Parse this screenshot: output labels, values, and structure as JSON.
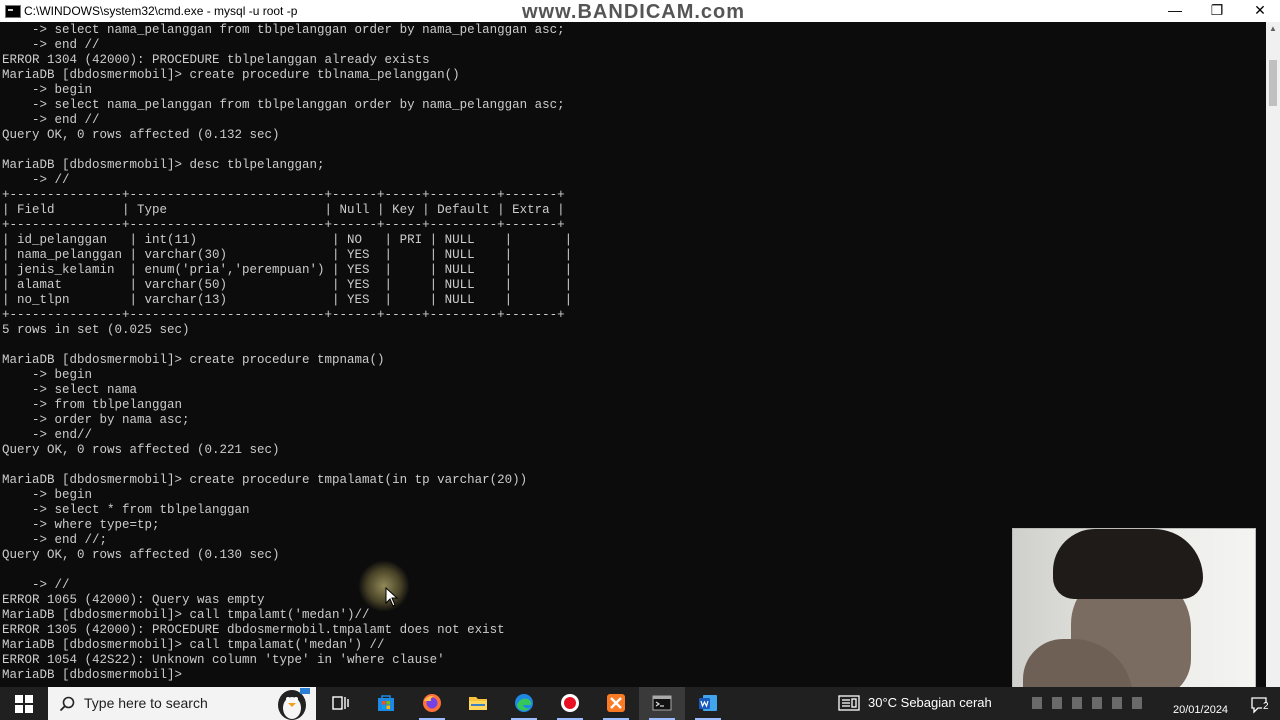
{
  "window": {
    "title": "C:\\WINDOWS\\system32\\cmd.exe - mysql  -u root -p",
    "watermark": "www.BANDICAM.com",
    "minimize_label": "—",
    "maximize_label": "❐",
    "close_label": "✕"
  },
  "console": {
    "lines": [
      "    -> select nama_pelanggan from tblpelanggan order by nama_pelanggan asc;",
      "    -> end //",
      "ERROR 1304 (42000): PROCEDURE tblpelanggan already exists",
      "MariaDB [dbdosmermobil]> create procedure tblnama_pelanggan()",
      "    -> begin",
      "    -> select nama_pelanggan from tblpelanggan order by nama_pelanggan asc;",
      "    -> end //",
      "Query OK, 0 rows affected (0.132 sec)",
      "",
      "MariaDB [dbdosmermobil]> desc tblpelanggan;",
      "    -> //",
      "+---------------+--------------------------+------+-----+---------+-------+",
      "| Field         | Type                     | Null | Key | Default | Extra |",
      "+---------------+--------------------------+------+-----+---------+-------+",
      "| id_pelanggan   | int(11)                  | NO   | PRI | NULL    |       |",
      "| nama_pelanggan | varchar(30)              | YES  |     | NULL    |       |",
      "| jenis_kelamin  | enum('pria','perempuan') | YES  |     | NULL    |       |",
      "| alamat         | varchar(50)              | YES  |     | NULL    |       |",
      "| no_tlpn        | varchar(13)              | YES  |     | NULL    |       |",
      "+---------------+--------------------------+------+-----+---------+-------+",
      "5 rows in set (0.025 sec)",
      "",
      "MariaDB [dbdosmermobil]> create procedure tmpnama()",
      "    -> begin",
      "    -> select nama",
      "    -> from tblpelanggan",
      "    -> order by nama asc;",
      "    -> end//",
      "Query OK, 0 rows affected (0.221 sec)",
      "",
      "MariaDB [dbdosmermobil]> create procedure tmpalamat(in tp varchar(20))",
      "    -> begin",
      "    -> select * from tblpelanggan",
      "    -> where type=tp;",
      "    -> end //;",
      "Query OK, 0 rows affected (0.130 sec)",
      "",
      "    -> //",
      "ERROR 1065 (42000): Query was empty",
      "MariaDB [dbdosmermobil]> call tmpalamt('medan')//",
      "ERROR 1305 (42000): PROCEDURE dbdosmermobil.tmpalamt does not exist",
      "MariaDB [dbdosmermobil]> call tmpalamat('medan') //",
      "ERROR 1054 (42S22): Unknown column 'type' in 'where clause'",
      "MariaDB [dbdosmermobil]> "
    ]
  },
  "taskbar": {
    "search_placeholder": "Type here to search",
    "weather": "30°C  Sebagian cerah",
    "date": "20/01/2024",
    "notification_count": "2"
  },
  "colors": {
    "console_bg": "#0c0c0c",
    "console_text": "#cccccc",
    "taskbar_bg": "#202020"
  },
  "icons": {
    "start": "windows-logo-icon",
    "search": "search-icon",
    "taskview": "task-view-icon",
    "store": "microsoft-store-icon",
    "firefox": "firefox-icon",
    "explorer": "file-explorer-icon",
    "edge": "edge-icon",
    "obs": "record-icon",
    "xampp": "xampp-icon",
    "cmd": "command-prompt-icon",
    "word": "word-icon",
    "weather": "weather-icon"
  }
}
